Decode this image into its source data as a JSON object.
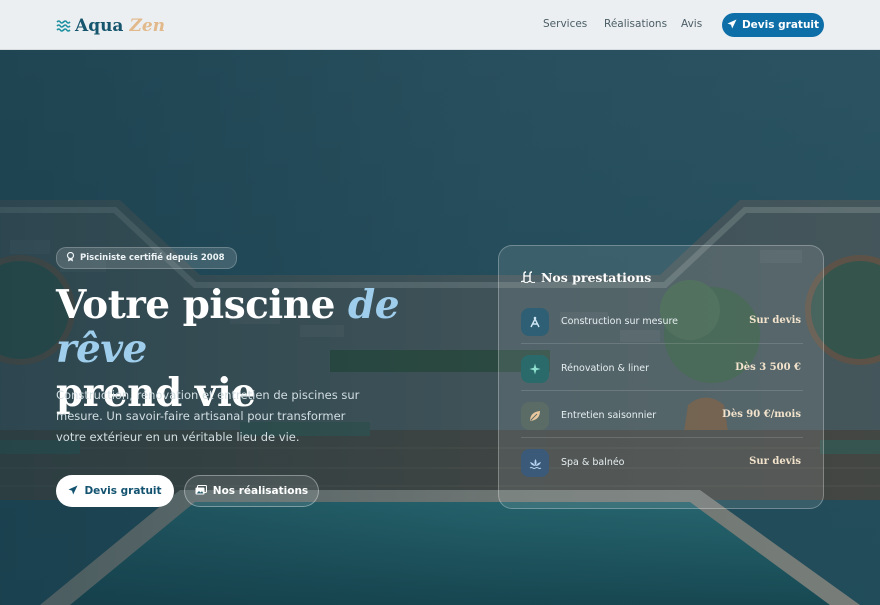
{
  "header": {
    "logo": {
      "word1": "Aqua",
      "word2": "Zen",
      "icon": "waves-icon"
    },
    "nav": [
      {
        "label": "Services"
      },
      {
        "label": "Réalisations"
      },
      {
        "label": "Avis"
      }
    ],
    "cta": {
      "label": "Devis gratuit",
      "icon": "paper-plane-icon"
    }
  },
  "hero": {
    "badge": {
      "label": "Pisciniste certifié depuis 2008",
      "icon": "award-icon"
    },
    "title": {
      "line1_plain": "Votre piscine ",
      "line1_accent": "de rêve",
      "line2": "prend vie"
    },
    "lead": "Construction, rénovation et entretien de piscines sur mesure. Un savoir-faire artisanal pour transformer votre extérieur en un véritable lieu de vie.",
    "primary_button": {
      "label": "Devis gratuit",
      "icon": "paper-plane-icon"
    },
    "secondary_button": {
      "label": "Nos réalisations",
      "icon": "images-icon"
    }
  },
  "services_card": {
    "title": "Nos prestations",
    "icon": "pool-ladder-icon",
    "items": [
      {
        "name": "Construction sur mesure",
        "price": "Sur devis",
        "icon": "compass-icon",
        "icon_bg": "#2f5f74"
      },
      {
        "name": "Rénovation & liner",
        "price": "Dès 3 500 €",
        "icon": "sparkle-icon",
        "icon_bg": "#2a6a6a"
      },
      {
        "name": "Entretien saisonnier",
        "price": "Dès 90 €/mois",
        "icon": "leaf-icon",
        "icon_bg": "#5b6b66"
      },
      {
        "name": "Spa & balnéo",
        "price": "Sur devis",
        "icon": "lotus-icon",
        "icon_bg": "#3b5a7a"
      }
    ]
  },
  "colors": {
    "brand_primary": "#0e6fa8",
    "brand_dark": "#15556d",
    "accent_gold": "#e2b98a",
    "accent_blue": "#9fcdec"
  }
}
